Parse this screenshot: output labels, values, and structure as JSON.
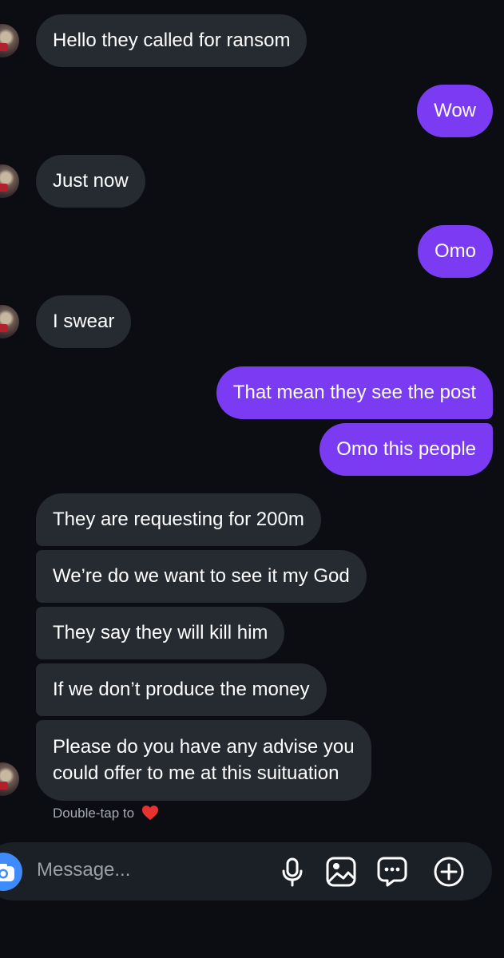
{
  "messages": [
    {
      "from": "them",
      "text": "Hello they called for ransom"
    },
    {
      "from": "me",
      "text": "Wow"
    },
    {
      "from": "them",
      "text": "Just now"
    },
    {
      "from": "me",
      "text": "Omo"
    },
    {
      "from": "them",
      "text": "I swear"
    },
    {
      "from": "me",
      "text": "That mean they see the post"
    },
    {
      "from": "me",
      "text": "Omo this people"
    },
    {
      "from": "them",
      "text": "They are requesting for 200m"
    },
    {
      "from": "them",
      "text": "We’re do we want to see it my God"
    },
    {
      "from": "them",
      "text": "They say they will kill him"
    },
    {
      "from": "them",
      "text": "If we don’t produce the money"
    },
    {
      "from": "them",
      "text_line1": "Please do you have any advise you",
      "text_line2": "could offer to me at this suituation"
    }
  ],
  "hint": {
    "text": "Double-tap to",
    "icon": "heart-icon"
  },
  "composer": {
    "placeholder": "Message...",
    "icons": [
      "camera-icon",
      "microphone-icon",
      "gallery-icon",
      "sticker-chat-icon",
      "add-icon"
    ]
  },
  "colors": {
    "background": "#0b0d12",
    "incoming_bubble": "#262a31",
    "outgoing_bubble": "#7b3bf2",
    "camera_button": "#3d8bfd"
  }
}
